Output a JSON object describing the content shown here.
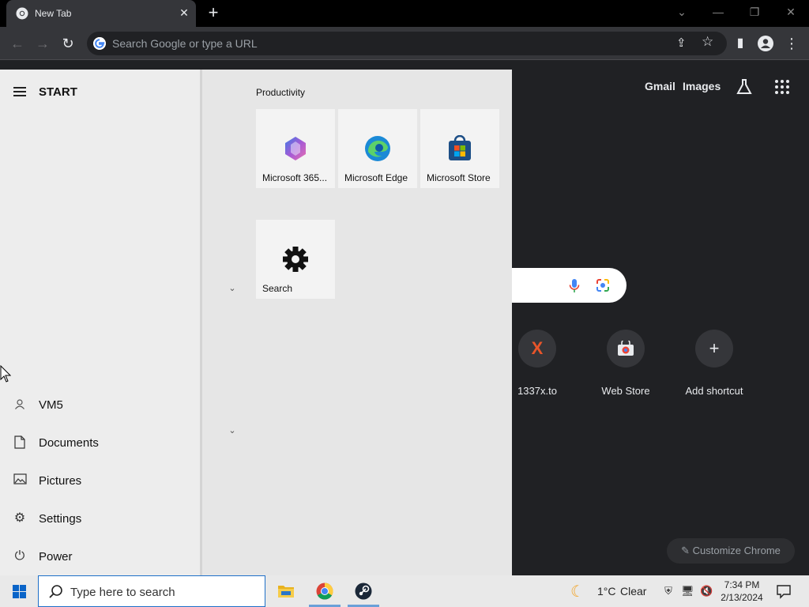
{
  "browser": {
    "tab_title": "New Tab",
    "omnibox_placeholder": "Search Google or type a URL"
  },
  "ntp": {
    "gmail": "Gmail",
    "images": "Images",
    "shortcuts": [
      {
        "label": "1337x.to"
      },
      {
        "label": "Web Store"
      },
      {
        "label": "Add shortcut"
      }
    ],
    "customize_label": "Customize Chrome"
  },
  "start_menu": {
    "title": "START",
    "nav": [
      {
        "label": "VM5",
        "icon": "user-icon"
      },
      {
        "label": "Documents",
        "icon": "document-icon"
      },
      {
        "label": "Pictures",
        "icon": "pictures-icon"
      },
      {
        "label": "Settings",
        "icon": "gear-icon"
      },
      {
        "label": "Power",
        "icon": "power-icon"
      }
    ],
    "group_label": "Productivity",
    "tiles": [
      {
        "label": "Microsoft 365...",
        "icon": "microsoft-365-icon"
      },
      {
        "label": "Microsoft Edge",
        "icon": "edge-icon"
      },
      {
        "label": "Microsoft Store",
        "icon": "store-icon"
      },
      {
        "label": "Search",
        "icon": "gear-icon"
      }
    ]
  },
  "taskbar": {
    "search_placeholder": "Type here to search",
    "weather": {
      "temp": "1°C",
      "condition": "Clear"
    },
    "time": "7:34 PM",
    "date": "2/13/2024"
  },
  "colors": {
    "chrome_dark": "#35363a",
    "ntp_bg": "#202124",
    "start_bg": "#e6e6e6",
    "taskbar_bg": "#e9e9e9",
    "accent": "#1e6fc8"
  }
}
